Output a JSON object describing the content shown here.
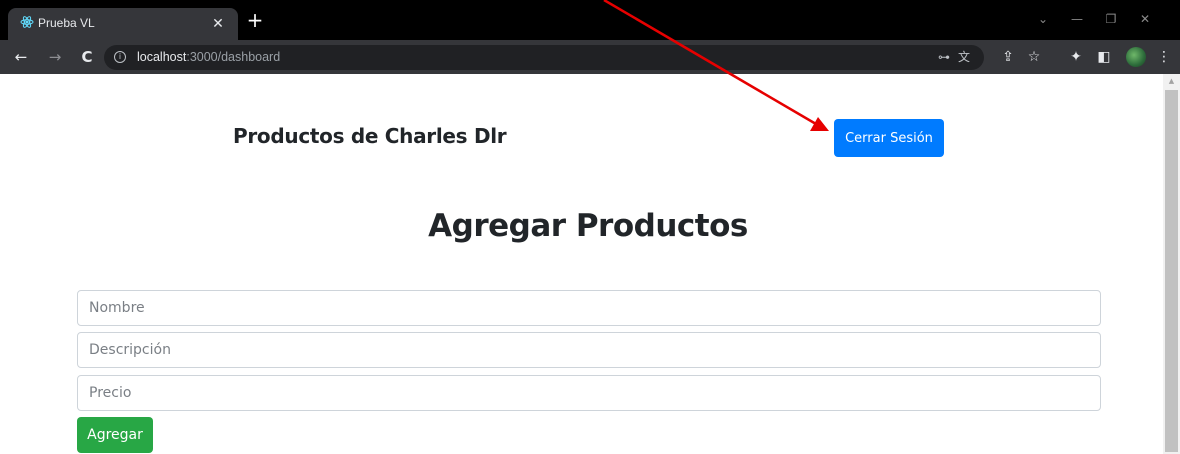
{
  "tab": {
    "title": "Prueba VL",
    "close_glyph": "✕",
    "newtab_glyph": "+",
    "favicon": "react-icon"
  },
  "window_controls": {
    "dropdown_glyph": "⌄",
    "minimize_glyph": "—",
    "restore_glyph": "❐",
    "close_glyph": "✕"
  },
  "toolbar": {
    "back_glyph": "←",
    "forward_glyph": "→",
    "reload_glyph": "C",
    "info_glyph": "i",
    "url_host": "localhost",
    "url_rest": ":3000/dashboard",
    "icons": [
      "key-icon",
      "translate-icon",
      "share-icon",
      "star-icon",
      "extensions-icon",
      "sidepanel-icon",
      "profile-avatar",
      "menu-icon"
    ],
    "key_glyph": "⊶",
    "translate_glyph": "文",
    "share_glyph": "⇪",
    "star_glyph": "☆",
    "extensions_glyph": "✦",
    "sidepanel_glyph": "◧",
    "menu_glyph": "⋮"
  },
  "header": {
    "brand": "Productos de Charles Dlr",
    "logout_label": "Cerrar Sesión"
  },
  "main": {
    "heading": "Agregar Productos",
    "fields": {
      "name_placeholder": "Nombre",
      "description_placeholder": "Descripción",
      "price_placeholder": "Precio"
    },
    "submit_label": "Agregar"
  },
  "colors": {
    "primary": "#007bff",
    "success": "#28a745",
    "annotation_arrow": "#e60000",
    "text": "#212529"
  }
}
